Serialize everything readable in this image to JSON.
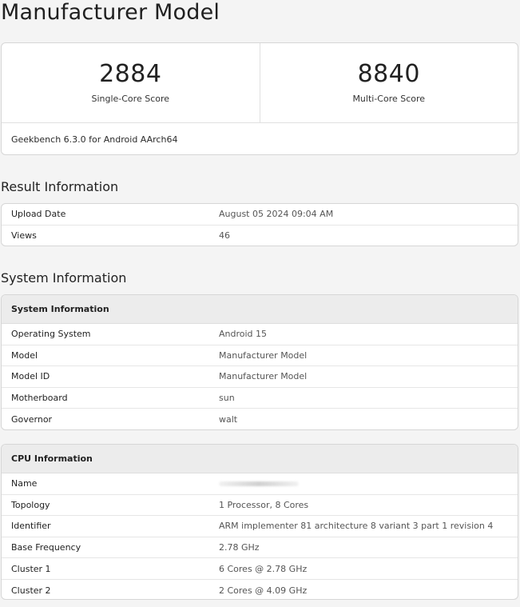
{
  "page": {
    "title": "Manufacturer Model"
  },
  "scores": {
    "single_core": {
      "value": "2884",
      "label": "Single-Core Score"
    },
    "multi_core": {
      "value": "8840",
      "label": "Multi-Core Score"
    },
    "version": "Geekbench 6.3.0 for Android AArch64"
  },
  "result_information": {
    "heading": "Result Information",
    "rows": [
      {
        "key": "Upload Date",
        "value": "August 05 2024 09:04 AM"
      },
      {
        "key": "Views",
        "value": "46"
      }
    ]
  },
  "system_information": {
    "heading": "System Information",
    "system_card": {
      "title": "System Information",
      "rows": [
        {
          "key": "Operating System",
          "value": "Android 15"
        },
        {
          "key": "Model",
          "value": "Manufacturer Model"
        },
        {
          "key": "Model ID",
          "value": "Manufacturer Model"
        },
        {
          "key": "Motherboard",
          "value": "sun"
        },
        {
          "key": "Governor",
          "value": "walt"
        }
      ]
    },
    "cpu_card": {
      "title": "CPU Information",
      "rows": [
        {
          "key": "Name",
          "value": ""
        },
        {
          "key": "Topology",
          "value": "1 Processor, 8 Cores"
        },
        {
          "key": "Identifier",
          "value": "ARM implementer 81 architecture 8 variant 3 part 1 revision 4"
        },
        {
          "key": "Base Frequency",
          "value": "2.78 GHz"
        },
        {
          "key": "Cluster 1",
          "value": "6 Cores @ 2.78 GHz"
        },
        {
          "key": "Cluster 2",
          "value": "2 Cores @ 4.09 GHz"
        }
      ]
    }
  }
}
